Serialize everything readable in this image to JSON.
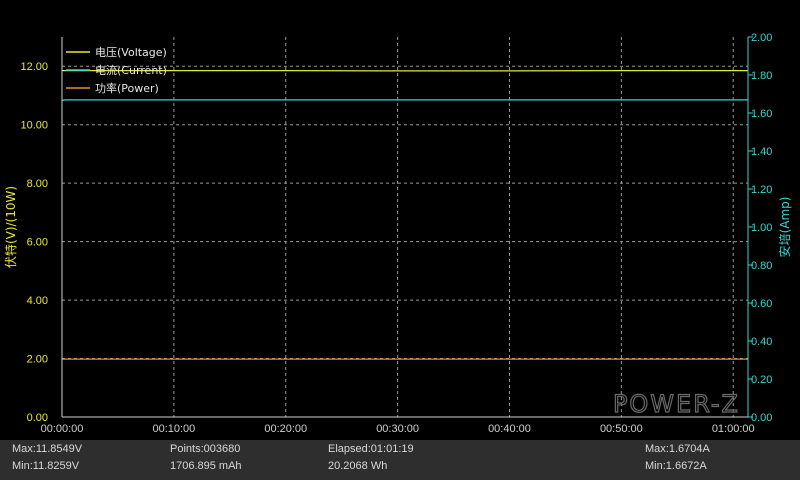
{
  "chart_data": {
    "type": "line",
    "legend": [
      "电压(Voltage)",
      "电流(Current)",
      "功率(Power)"
    ],
    "legend_placement": "top-left",
    "grid": true,
    "y_left": {
      "label": "伏特(V)/(10W)",
      "ticks": [
        "0.00",
        "2.00",
        "4.00",
        "6.00",
        "8.00",
        "10.00",
        "12.00"
      ],
      "range": [
        0,
        13
      ]
    },
    "y_right": {
      "label": "安培(Amp)",
      "ticks": [
        "0.00",
        "0.20",
        "0.40",
        "0.60",
        "0.80",
        "1.00",
        "1.20",
        "1.40",
        "1.60",
        "1.80",
        "2.00"
      ],
      "range": [
        0,
        2.0
      ]
    },
    "x": {
      "ticks": [
        "00:00:00",
        "00:10:00",
        "00:20:00",
        "00:30:00",
        "00:40:00",
        "00:50:00",
        "01:00:00"
      ],
      "range_minutes": [
        0,
        61.32
      ]
    },
    "series": [
      {
        "name": "电压(Voltage)",
        "axis": "left",
        "color": "#e8e830",
        "x_minutes": [
          0,
          10,
          20,
          30,
          40,
          50,
          61.32
        ],
        "values": [
          11.85,
          11.85,
          11.85,
          11.84,
          11.84,
          11.85,
          11.85
        ]
      },
      {
        "name": "电流(Current)",
        "axis": "right",
        "color": "#30d8d0",
        "x_minutes": [
          0,
          0.3,
          10,
          20,
          30,
          40,
          50,
          61.32
        ],
        "values": [
          1.667,
          1.669,
          1.669,
          1.669,
          1.669,
          1.669,
          1.669,
          1.669
        ]
      },
      {
        "name": "功率(Power)",
        "axis": "left",
        "color": "#e0902a",
        "x_minutes": [
          0,
          10,
          20,
          30,
          40,
          50,
          61.32
        ],
        "values": [
          1.98,
          1.98,
          1.98,
          1.98,
          1.98,
          1.98,
          1.98
        ]
      }
    ],
    "watermark": "POWER-Z"
  },
  "colors": {
    "voltage": "#e8e830",
    "current": "#30d8d0",
    "power": "#e0902a",
    "grid": "#9a9a9a",
    "axis": "#cfcfcf"
  },
  "stats": {
    "max_v": "Max:11.8549V",
    "min_v": "Min:11.8259V",
    "points": "Points:003680",
    "mah": "1706.895 mAh",
    "elapsed": "Elapsed:01:01:19",
    "wh": "20.2068 Wh",
    "max_a": "Max:1.6704A",
    "min_a": "Min:1.6672A"
  }
}
